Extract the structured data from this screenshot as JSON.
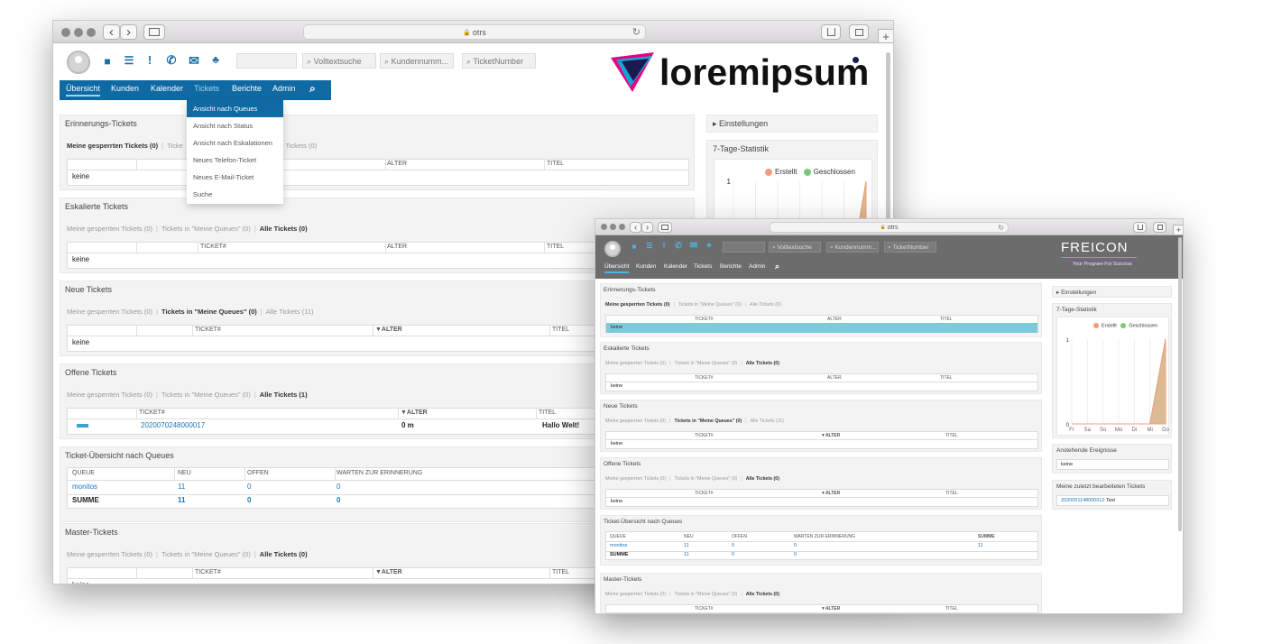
{
  "browser": {
    "url": "otrs",
    "lock": "🔒",
    "back": "‹",
    "forward": "›",
    "reload": "↻",
    "plus": "+"
  },
  "search": {
    "volltext": "Volltextsuche",
    "kunden": "Kundennumm...",
    "ticketnumber": "TicketNumber"
  },
  "logo_a": {
    "text": "loremipsum",
    "colors": [
      "#1a1a4e",
      "#e6007e",
      "#17a2d6"
    ]
  },
  "logo_b": {
    "text": "FREICON",
    "slogan": "Your Program For Success"
  },
  "nav": {
    "items": [
      "Übersicht",
      "Kunden",
      "Kalender",
      "Tickets",
      "Berichte",
      "Admin"
    ],
    "search_icon": "search-icon"
  },
  "dropdown": {
    "items": [
      "Ansicht nach Queues",
      "Ansicht nach Status",
      "Ansicht nach Eskalationen",
      "Neues Telefon-Ticket",
      "Neues E-Mail-Ticket",
      "Suche"
    ]
  },
  "filters": {
    "locked": "Meine gesperrten Tickets (0)",
    "my_queues_0": "Tickets in \"Meine Queues\" (0)",
    "all_0": "Alle Tickets (0)",
    "all_11": "Alle Tickets (11)",
    "all_1": "Alle Tickets (1)",
    "ticke_trunc": "Ticke",
    "lle_trunc": "lle Tickets (0)"
  },
  "headers": {
    "ticket": "TICKET#",
    "alter": "ALTER",
    "alter_sorted": "▼ALTER",
    "titel": "TITEL",
    "queue": "QUEUE",
    "neu": "NEU",
    "offen": "OFFEN",
    "warten": "WARTEN ZUR ERINNERUNG",
    "summe": "SUMME"
  },
  "widgets": {
    "erinnerung": "Erinnerungs-Tickets",
    "eskaliert": "Eskalierte Tickets",
    "neu": "Neue Tickets",
    "offen": "Offene Tickets",
    "queues": "Ticket-Übersicht nach Queues",
    "master": "Master-Tickets",
    "keine": "keine",
    "keine_partial": "keine"
  },
  "offene": {
    "ticket_id": "2020070248000017",
    "age": "0 m",
    "title": "Hallo Welt!"
  },
  "queue_rows": {
    "monitos": {
      "name": "monitos",
      "neu": "11",
      "offen": "0",
      "warten": "0",
      "summe": "11"
    },
    "summe": {
      "name": "SUMME",
      "neu": "11",
      "offen": "0",
      "warten": "0"
    }
  },
  "sidebar": {
    "einstellungen": "Einstellungen",
    "stat_title": "7-Tage-Statistik",
    "legend_created": "Erstellt",
    "legend_closed": "Geschlossen",
    "upcoming": "Anstehende Ereignisse",
    "upcoming_value": "keine",
    "recent": "Meine zuletzt bearbeiteten Tickets",
    "recent_ticket": "2020051148000012",
    "recent_ticket_title": "Test"
  },
  "chart_data": [
    {
      "type": "area",
      "categories": [
        "Fr",
        "Sa",
        "So",
        "Mo",
        "Di",
        "Mi",
        "Do"
      ],
      "series": [
        {
          "name": "Erstellt",
          "values": [
            0,
            0,
            0,
            0,
            0,
            0,
            1
          ]
        },
        {
          "name": "Geschlossen",
          "values": [
            0,
            0,
            0,
            0,
            0,
            0,
            1
          ]
        }
      ],
      "ylim": [
        0,
        1
      ],
      "yticks": [
        "0",
        "1"
      ],
      "colors": {
        "Erstellt": "#f59d7a",
        "Geschlossen": "#7dc57b"
      }
    }
  ]
}
